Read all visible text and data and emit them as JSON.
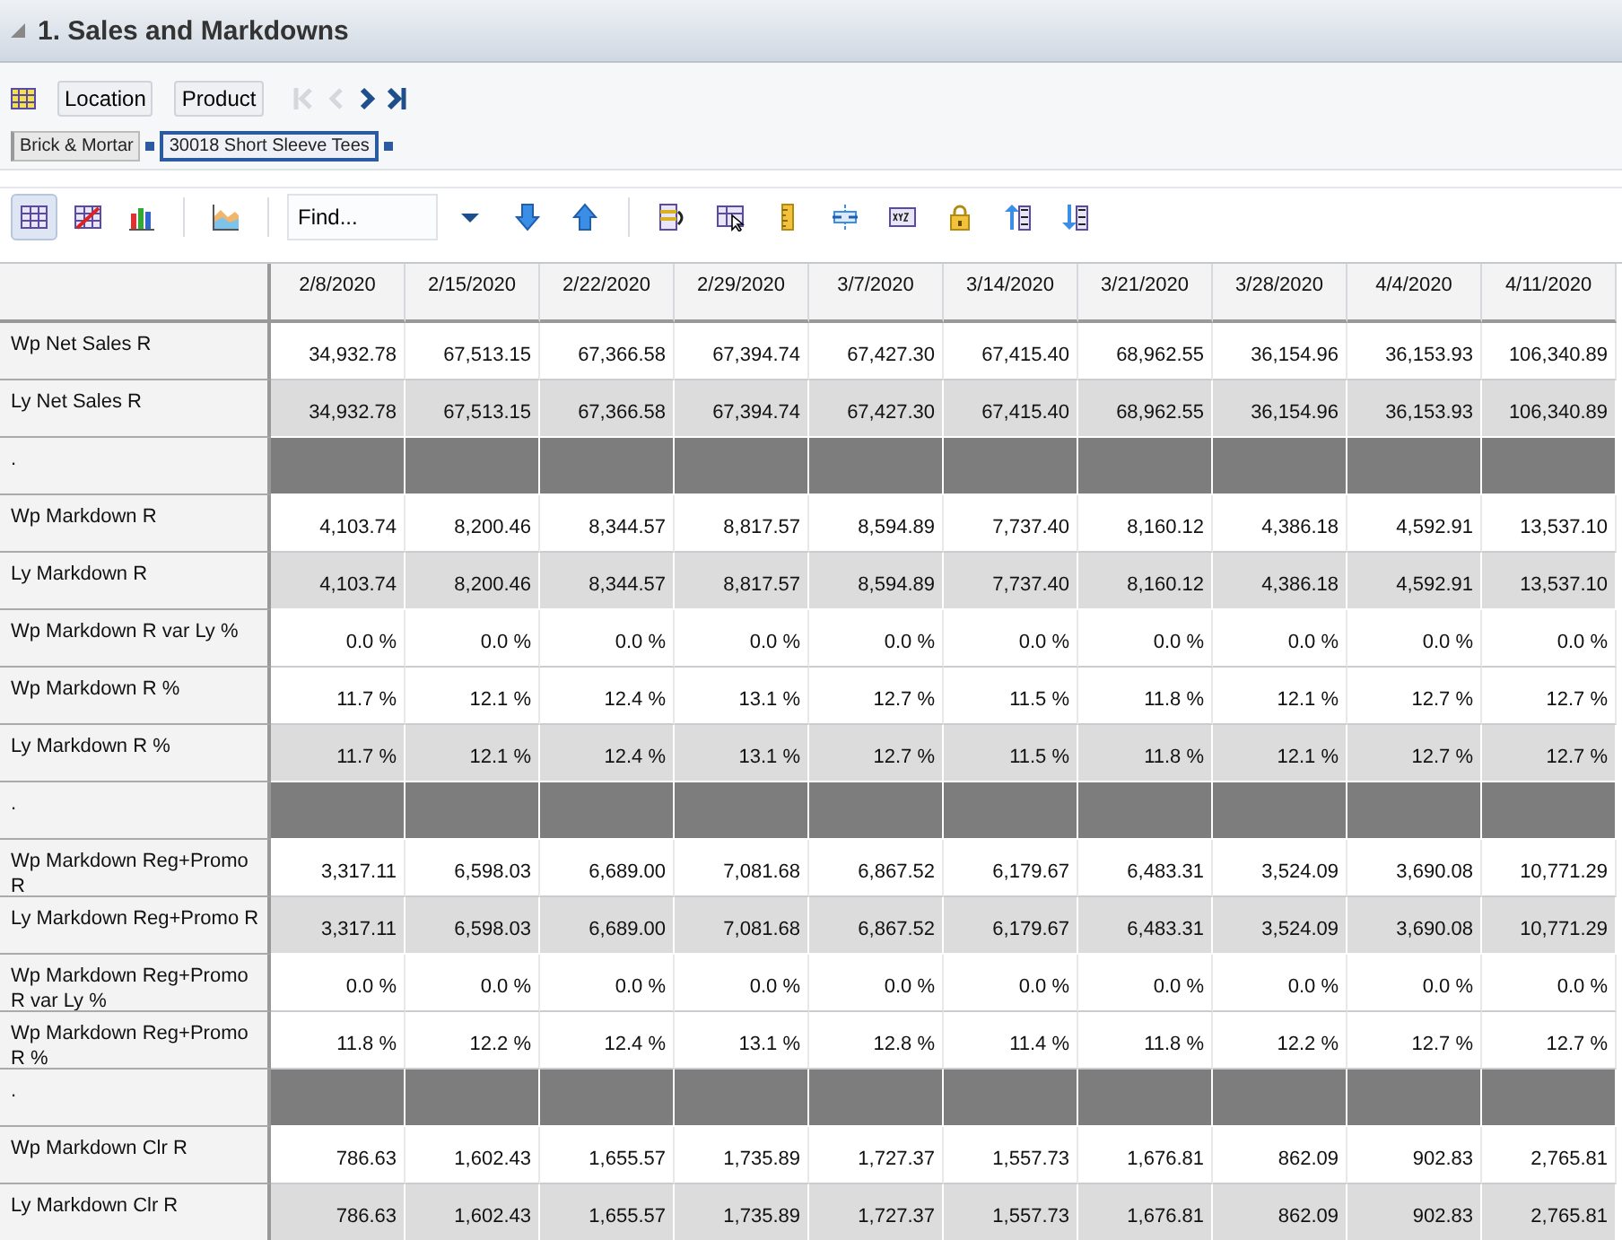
{
  "panel": {
    "title": "1. Sales and Markdowns",
    "expanded": true
  },
  "dimension_bar": {
    "buttons": [
      "Location",
      "Product"
    ],
    "nav": [
      {
        "kind": "first",
        "disabled": true
      },
      {
        "kind": "previous",
        "disabled": true
      },
      {
        "kind": "next",
        "disabled": false
      },
      {
        "kind": "last",
        "disabled": false
      }
    ],
    "breadcrumbs": [
      {
        "label": "Brick & Mortar",
        "selected": false
      },
      {
        "label": "30018 Short Sleeve Tees",
        "selected": true
      }
    ]
  },
  "toolbar": {
    "views": [
      {
        "kind": "table",
        "selected": true
      },
      {
        "kind": "chart-table",
        "selected": false
      },
      {
        "kind": "bar-chart",
        "selected": false
      },
      {
        "kind": "area-chart",
        "selected": false
      }
    ],
    "find": {
      "placeholder": "Find..."
    }
  },
  "table": {
    "columns": [
      "2/8/2020",
      "2/15/2020",
      "2/22/2020",
      "2/29/2020",
      "3/7/2020",
      "3/14/2020",
      "3/21/2020",
      "3/28/2020",
      "4/4/2020",
      "4/11/2020"
    ],
    "rows": [
      {
        "label": "Wp Net Sales R",
        "kind": "plan",
        "cells": [
          "34,932.78",
          "67,513.15",
          "67,366.58",
          "67,394.74",
          "67,427.30",
          "67,415.40",
          "68,962.55",
          "36,154.96",
          "36,153.93",
          "106,340.89"
        ]
      },
      {
        "label": "Ly Net Sales R",
        "kind": "last-year",
        "cells": [
          "34,932.78",
          "67,513.15",
          "67,366.58",
          "67,394.74",
          "67,427.30",
          "67,415.40",
          "68,962.55",
          "36,154.96",
          "36,153.93",
          "106,340.89"
        ]
      },
      {
        "label": ".",
        "kind": "separator"
      },
      {
        "label": "Wp Markdown R",
        "kind": "plan",
        "cells": [
          "4,103.74",
          "8,200.46",
          "8,344.57",
          "8,817.57",
          "8,594.89",
          "7,737.40",
          "8,160.12",
          "4,386.18",
          "4,592.91",
          "13,537.10"
        ]
      },
      {
        "label": "Ly Markdown R",
        "kind": "last-year",
        "cells": [
          "4,103.74",
          "8,200.46",
          "8,344.57",
          "8,817.57",
          "8,594.89",
          "7,737.40",
          "8,160.12",
          "4,386.18",
          "4,592.91",
          "13,537.10"
        ]
      },
      {
        "label": "Wp Markdown R var Ly %",
        "kind": "plan",
        "cells": [
          "0.0 %",
          "0.0 %",
          "0.0 %",
          "0.0 %",
          "0.0 %",
          "0.0 %",
          "0.0 %",
          "0.0 %",
          "0.0 %",
          "0.0 %"
        ]
      },
      {
        "label": "Wp Markdown R %",
        "kind": "plan",
        "cells": [
          "11.7 %",
          "12.1 %",
          "12.4 %",
          "13.1 %",
          "12.7 %",
          "11.5 %",
          "11.8 %",
          "12.1 %",
          "12.7 %",
          "12.7 %"
        ]
      },
      {
        "label": "Ly Markdown R %",
        "kind": "last-year",
        "cells": [
          "11.7 %",
          "12.1 %",
          "12.4 %",
          "13.1 %",
          "12.7 %",
          "11.5 %",
          "11.8 %",
          "12.1 %",
          "12.7 %",
          "12.7 %"
        ]
      },
      {
        "label": ".",
        "kind": "separator"
      },
      {
        "label": "Wp Markdown Reg+Promo R",
        "kind": "plan",
        "cells": [
          "3,317.11",
          "6,598.03",
          "6,689.00",
          "7,081.68",
          "6,867.52",
          "6,179.67",
          "6,483.31",
          "3,524.09",
          "3,690.08",
          "10,771.29"
        ]
      },
      {
        "label": "Ly Markdown Reg+Promo R",
        "kind": "last-year",
        "cells": [
          "3,317.11",
          "6,598.03",
          "6,689.00",
          "7,081.68",
          "6,867.52",
          "6,179.67",
          "6,483.31",
          "3,524.09",
          "3,690.08",
          "10,771.29"
        ]
      },
      {
        "label": "Wp Markdown Reg+Promo R var Ly %",
        "kind": "plan",
        "cells": [
          "0.0 %",
          "0.0 %",
          "0.0 %",
          "0.0 %",
          "0.0 %",
          "0.0 %",
          "0.0 %",
          "0.0 %",
          "0.0 %",
          "0.0 %"
        ]
      },
      {
        "label": "Wp Markdown Reg+Promo R %",
        "kind": "plan",
        "cells": [
          "11.8 %",
          "12.2 %",
          "12.4 %",
          "13.1 %",
          "12.8 %",
          "11.4 %",
          "11.8 %",
          "12.2 %",
          "12.7 %",
          "12.7 %"
        ]
      },
      {
        "label": ".",
        "kind": "separator"
      },
      {
        "label": "Wp Markdown Clr R",
        "kind": "plan",
        "cells": [
          "786.63",
          "1,602.43",
          "1,655.57",
          "1,735.89",
          "1,727.37",
          "1,557.73",
          "1,676.81",
          "862.09",
          "902.83",
          "2,765.81"
        ]
      },
      {
        "label": "Ly Markdown Clr R",
        "kind": "last-year",
        "cells": [
          "786.63",
          "1,602.43",
          "1,655.57",
          "1,735.89",
          "1,727.37",
          "1,557.73",
          "1,676.81",
          "862.09",
          "902.83",
          "2,765.81"
        ]
      }
    ]
  }
}
